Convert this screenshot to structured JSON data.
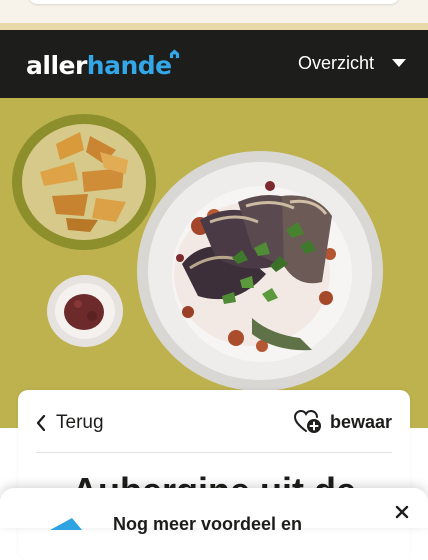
{
  "header": {
    "logo_part_a": "aller",
    "logo_part_b": "hande",
    "menu_label": "Overzicht"
  },
  "recipe_card": {
    "back_label": "Terug",
    "save_label": "bewaar",
    "title": "Aubergine uit de"
  },
  "promo_banner": {
    "text": "Nog meer voordeel en"
  },
  "colors": {
    "header_bg": "#1d1d1b",
    "logo_accent": "#33a7e8",
    "hero_bg": "#c2b553",
    "promo_accent": "#2ea3e2"
  },
  "icons": {
    "menu": "caret-down-icon",
    "back": "chevron-left-icon",
    "save": "heart-plus-icon",
    "close": "close-icon"
  }
}
